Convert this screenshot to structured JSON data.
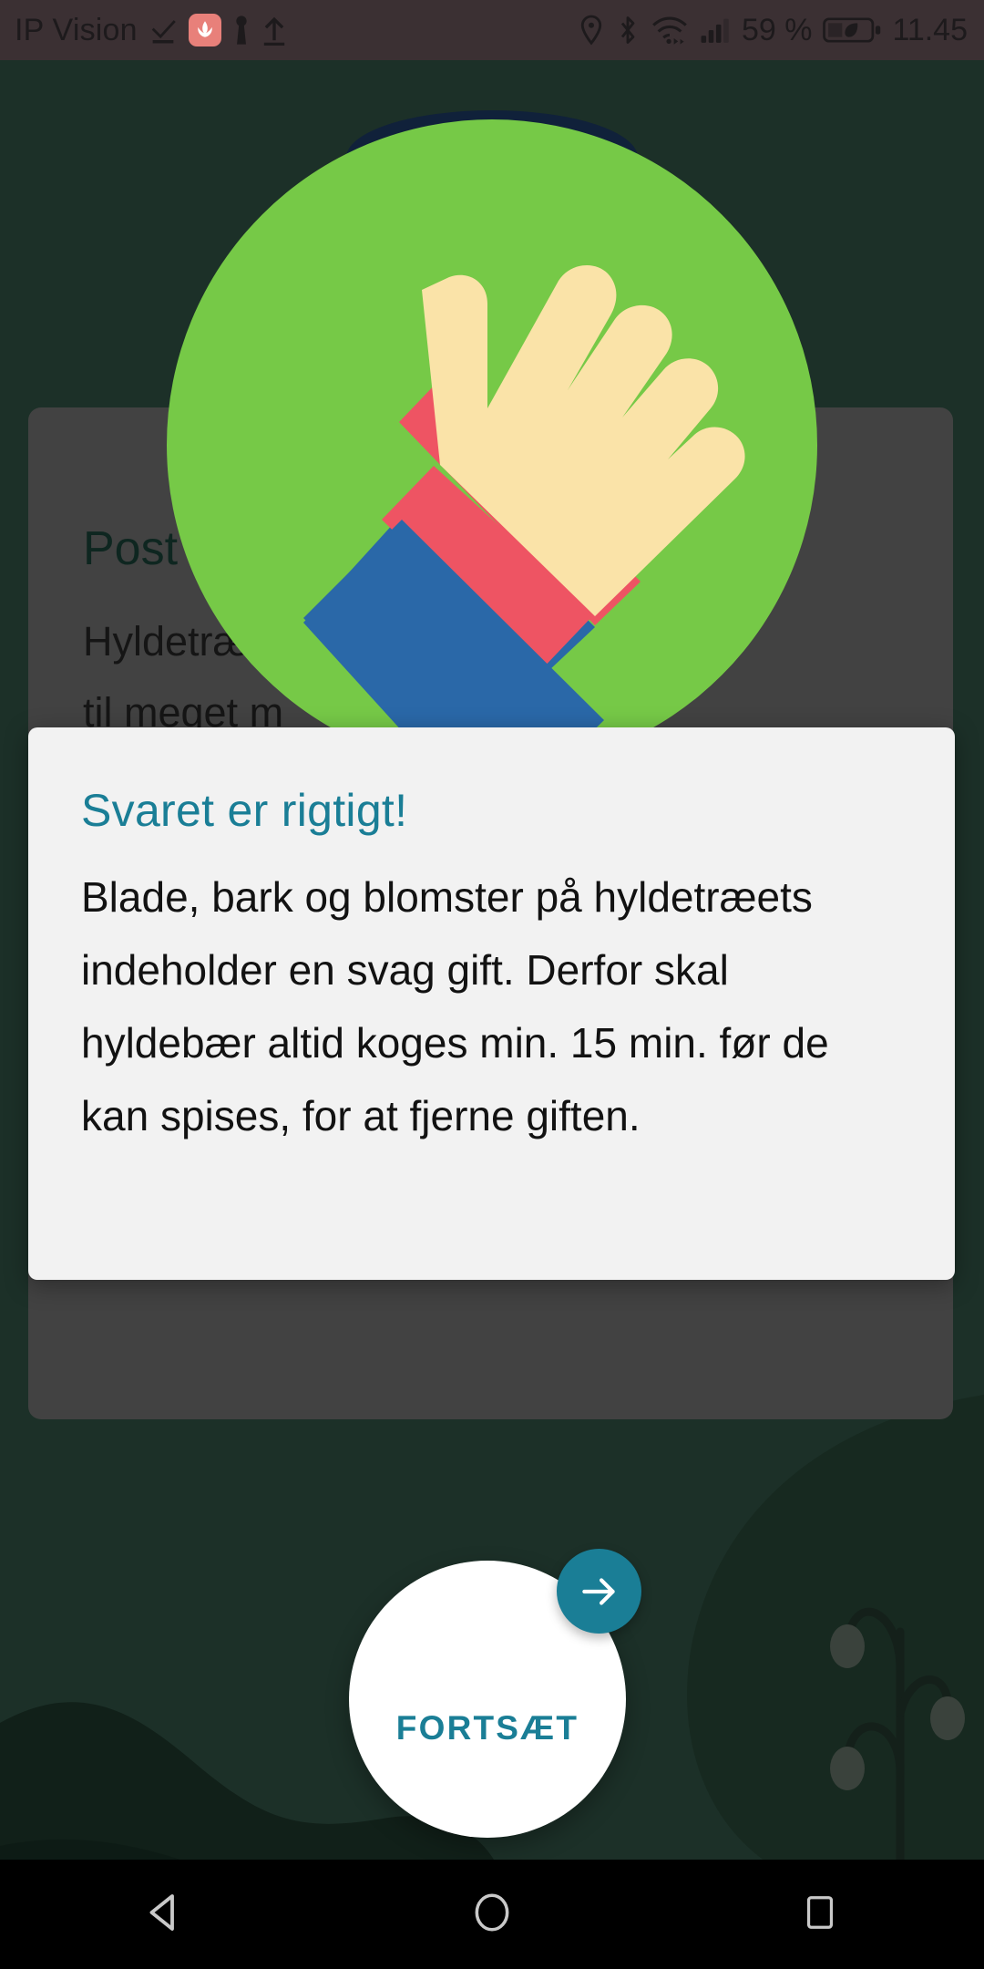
{
  "status_bar": {
    "carrier": "IP Vision",
    "left_icons": [
      "signal-check-icon",
      "huawei-logo-icon",
      "vpn-key-icon",
      "upload-arrow-icon"
    ],
    "right_icons": [
      "location-pin-icon",
      "bluetooth-icon",
      "wifi-icon",
      "cellular-signal-icon"
    ],
    "battery_percent": "59 %",
    "battery_icon": "battery-power-saving-leaf-icon",
    "clock": "11.45"
  },
  "question_card": {
    "title": "Post",
    "body": "Hyldetræ                    bruges\ntil meget m",
    "option_placeholder": ""
  },
  "illustration": {
    "name": "thumbs-up-illustration",
    "circle_color": "#76C947",
    "hand_color": "#FAE3A8",
    "cuff_color": "#EE5463",
    "sleeve_color": "#2A68A8"
  },
  "dialog": {
    "title": "Svaret er rigtigt!",
    "body": "Blade, bark og blomster på hyldetræets indeholder en svag gift. Derfor skal hyldebær altid koges min. 15 min. før de kan spises, for at fjerne giften.",
    "title_color": "#1A7E96"
  },
  "cta": {
    "label": "FORTSÆT",
    "arrow_icon": "arrow-right-icon",
    "accent_color": "#1A7E96"
  },
  "nav_bar": {
    "back": "back-triangle-icon",
    "home": "home-circle-icon",
    "recents": "recents-square-icon"
  },
  "theme": {
    "background_green": "#1C3028",
    "status_bar_bg": "#3B3033",
    "scrim_card": "#424242",
    "dialog_bg": "#F2F2F2"
  }
}
